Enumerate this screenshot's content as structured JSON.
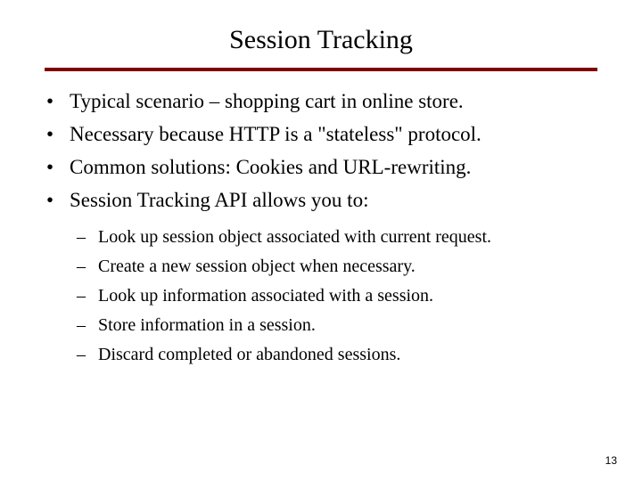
{
  "title": "Session Tracking",
  "bullets": [
    {
      "text": "Typical scenario – shopping cart in online store."
    },
    {
      "text": "Necessary because HTTP is a \"stateless\" protocol."
    },
    {
      "text": "Common solutions: Cookies and URL-rewriting."
    },
    {
      "text": "Session Tracking API allows you to:"
    }
  ],
  "subbullets": [
    {
      "text": "Look up session object associated with current request."
    },
    {
      "text": "Create a new session object when necessary."
    },
    {
      "text": "Look up information associated with a session."
    },
    {
      "text": "Store information in a session."
    },
    {
      "text": "Discard completed or abandoned sessions."
    }
  ],
  "pageNumber": "13",
  "markers": {
    "bullet": "•",
    "dash": "–"
  }
}
